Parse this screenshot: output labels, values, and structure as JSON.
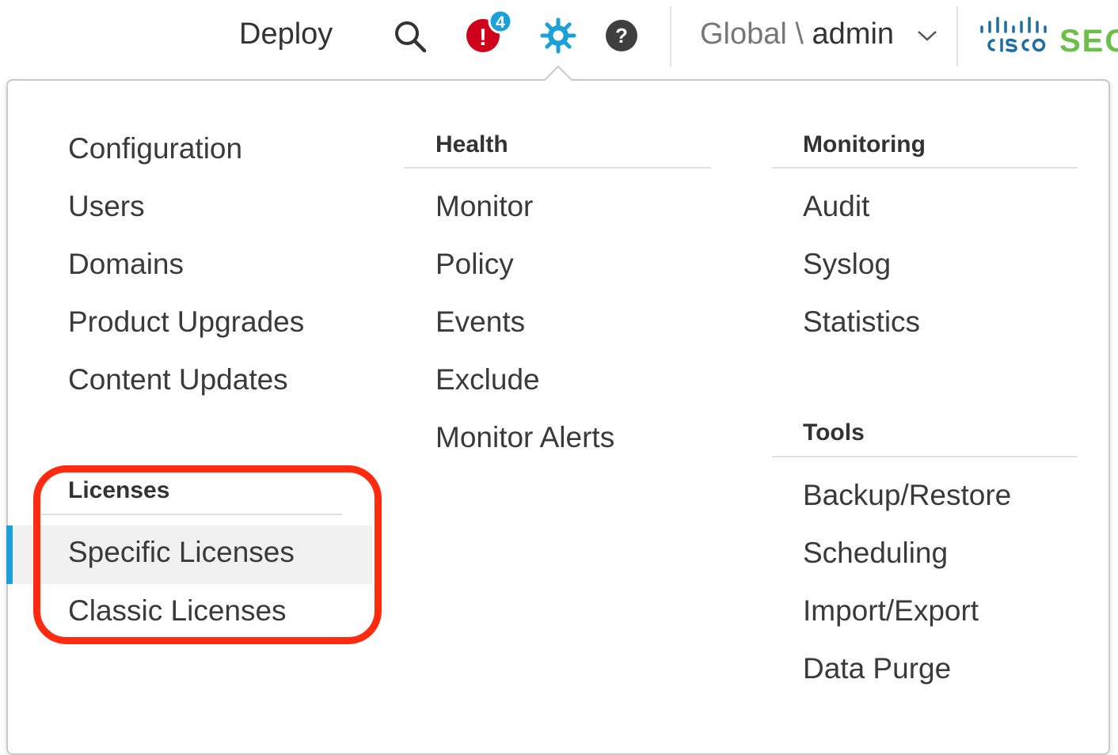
{
  "topbar": {
    "deploy_label": "Deploy",
    "alert_badge_count": "4",
    "alert_badge_symbol": "!",
    "help_symbol": "?",
    "domain_global": "Global",
    "domain_separator": " \\ ",
    "domain_user": "admin",
    "brand_partial": "SEC",
    "icons": [
      "search-icon",
      "alert-icon",
      "gear-icon",
      "help-icon",
      "chevron-down-icon",
      "cisco-logo"
    ]
  },
  "menu": {
    "system": {
      "items": [
        "Configuration",
        "Users",
        "Domains",
        "Product Upgrades",
        "Content Updates"
      ]
    },
    "licenses": {
      "header": "Licenses",
      "items": [
        "Specific Licenses",
        "Classic Licenses"
      ],
      "active_item": "Specific Licenses"
    },
    "health": {
      "header": "Health",
      "items": [
        "Monitor",
        "Policy",
        "Events",
        "Exclude",
        "Monitor Alerts"
      ]
    },
    "monitoring": {
      "header": "Monitoring",
      "items": [
        "Audit",
        "Syslog",
        "Statistics"
      ]
    },
    "tools": {
      "header": "Tools",
      "items": [
        "Backup/Restore",
        "Scheduling",
        "Import/Export",
        "Data Purge"
      ]
    }
  },
  "colors": {
    "accent_blue": "#1ba0d7",
    "alert_red": "#d0021b",
    "brand_green": "#6cc04a",
    "highlight_red": "#ff2a0f"
  }
}
